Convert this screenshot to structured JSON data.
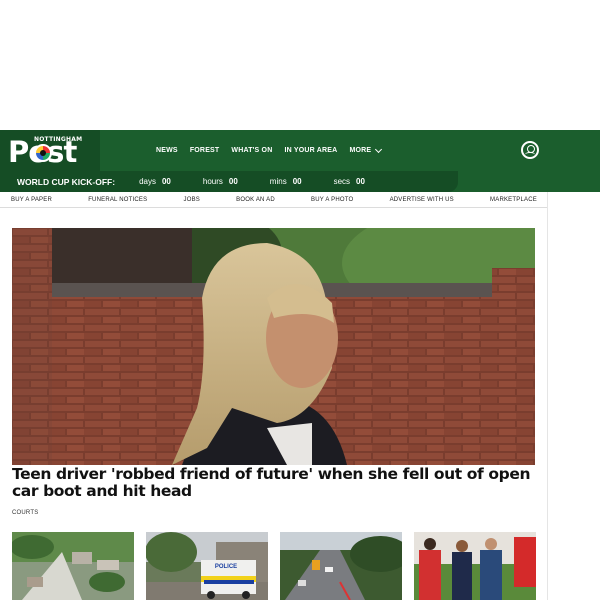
{
  "header": {
    "logo_small": "NOTTINGHAM",
    "logo_main": "Post",
    "nav": [
      "NEWS",
      "FOREST",
      "WHAT'S ON",
      "IN YOUR AREA",
      "MORE"
    ],
    "account_icon": "account-icon",
    "bg_color": "#1b5e2d"
  },
  "countdown": {
    "title": "WORLD CUP KICK-OFF:",
    "units": [
      {
        "label": "days",
        "value": "00"
      },
      {
        "label": "hours",
        "value": "00"
      },
      {
        "label": "mins",
        "value": "00"
      },
      {
        "label": "secs",
        "value": "00"
      }
    ]
  },
  "subnav": [
    "BUY A PAPER",
    "FUNERAL NOTICES",
    "JOBS",
    "BOOK AN AD",
    "BUY A PHOTO",
    "ADVERTISE WITH US",
    "MARKETPLACE"
  ],
  "lead": {
    "headline": "Teen driver 'robbed friend of future' when she fell out of open car boot and hit head",
    "tag": "COURTS"
  },
  "thumbs": [
    {
      "name": "aerial-estate-image"
    },
    {
      "name": "police-van-image",
      "label": "POLICE"
    },
    {
      "name": "road-works-image"
    },
    {
      "name": "football-players-image"
    }
  ]
}
